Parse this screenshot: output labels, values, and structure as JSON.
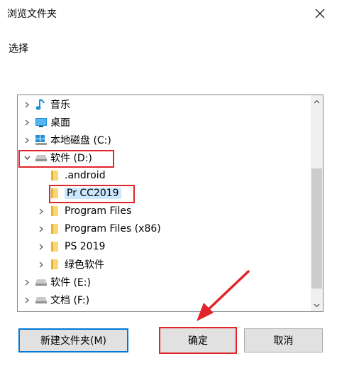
{
  "window": {
    "title": "浏览文件夹"
  },
  "prompt": "选择",
  "tree": {
    "items": [
      {
        "label": "音乐",
        "icon": "music-note-icon",
        "chevron": "right",
        "level": 0
      },
      {
        "label": "桌面",
        "icon": "desktop-icon",
        "chevron": "right",
        "level": 0
      },
      {
        "label": "本地磁盘 (C:)",
        "icon": "system-drive-icon",
        "chevron": "right",
        "level": 0
      },
      {
        "label": "软件 (D:)",
        "icon": "drive-icon",
        "chevron": "down",
        "level": 0
      },
      {
        "label": ".android",
        "icon": "folder-icon",
        "chevron": "none",
        "level": 1
      },
      {
        "label": "Pr CC2019",
        "icon": "folder-icon",
        "chevron": "none",
        "level": 1,
        "selected": true
      },
      {
        "label": "Program Files",
        "icon": "folder-icon",
        "chevron": "right",
        "level": 1
      },
      {
        "label": "Program Files (x86)",
        "icon": "folder-icon",
        "chevron": "right",
        "level": 1
      },
      {
        "label": "PS 2019",
        "icon": "folder-icon",
        "chevron": "right",
        "level": 1
      },
      {
        "label": "绿色软件",
        "icon": "folder-icon",
        "chevron": "right",
        "level": 1
      },
      {
        "label": "软件 (E:)",
        "icon": "drive-icon",
        "chevron": "right",
        "level": 0
      },
      {
        "label": "文档 (F:)",
        "icon": "drive-icon",
        "chevron": "right",
        "level": 0
      }
    ]
  },
  "buttons": {
    "new_folder": "新建文件夹(M)",
    "ok": "确定",
    "cancel": "取消"
  },
  "colors": {
    "highlight": "#e0262b",
    "selection": "#cce8ff",
    "folder": "#f8d775",
    "accent": "#0078d7"
  }
}
